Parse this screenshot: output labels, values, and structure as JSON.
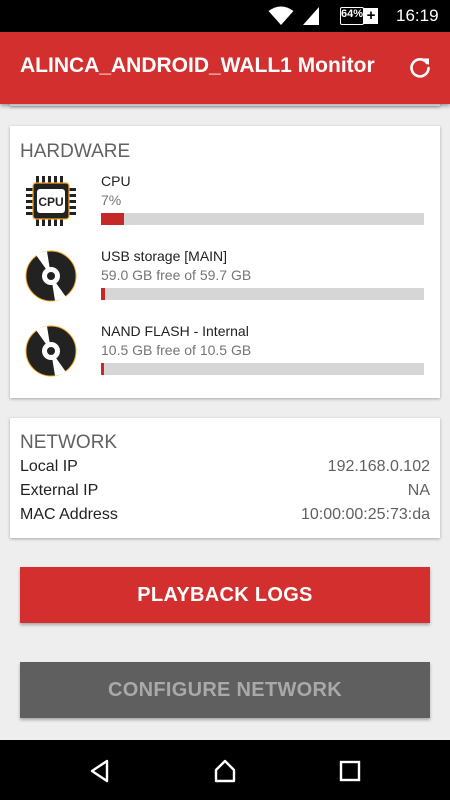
{
  "status_bar": {
    "battery_percent": "64%",
    "battery_charging_symbol": "+",
    "time": "16:19",
    "icons": [
      "wifi-icon",
      "signal-icon",
      "battery-icon"
    ]
  },
  "app_bar": {
    "title": "ALINCA_ANDROID_WALL1 Monitor",
    "refresh_icon": "refresh-icon"
  },
  "hardware": {
    "title": "HARDWARE",
    "items": [
      {
        "icon": "cpu-icon",
        "label": "CPU",
        "detail": "7%",
        "usage_fraction": 0.07
      },
      {
        "icon": "disc-icon",
        "label": "USB storage [MAIN]",
        "detail": "59.0 GB free of 59.7 GB",
        "usage_fraction": 0.012
      },
      {
        "icon": "disc-icon",
        "label": "NAND FLASH - Internal",
        "detail": "10.5 GB free of 10.5 GB",
        "usage_fraction": 0.005
      }
    ]
  },
  "network": {
    "title": "NETWORK",
    "rows": [
      {
        "key": "Local IP",
        "value": "192.168.0.102"
      },
      {
        "key": "External IP",
        "value": "NA"
      },
      {
        "key": "MAC Address",
        "value": "10:00:00:25:73:da"
      }
    ]
  },
  "buttons": {
    "playback_logs": "PLAYBACK LOGS",
    "configure_network": "CONFIGURE NETWORK"
  },
  "colors": {
    "accent": "#d32f2f",
    "bar_fill": "#c62828",
    "bar_track": "#d6d6d6",
    "disabled_button": "#5f5f5f"
  },
  "nav_bar": {
    "icons": [
      "back-icon",
      "home-icon",
      "recents-icon"
    ]
  }
}
